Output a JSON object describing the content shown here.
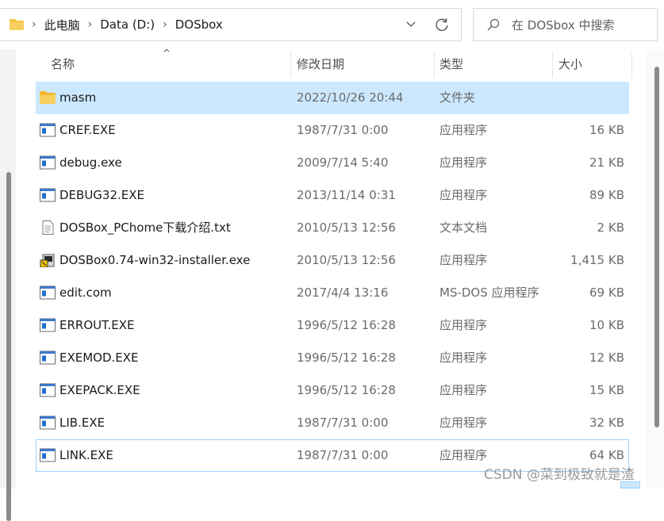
{
  "address_bar": {
    "breadcrumbs": [
      "此电脑",
      "Data (D:)",
      "DOSbox"
    ]
  },
  "search": {
    "placeholder": "在 DOSbox 中搜索"
  },
  "columns": {
    "name": "名称",
    "date": "修改日期",
    "type": "类型",
    "size": "大小"
  },
  "files": [
    {
      "name": "masm",
      "date": "2022/10/26 20:44",
      "type": "文件夹",
      "size": "",
      "icon": "folder-icon"
    },
    {
      "name": "CREF.EXE",
      "date": "1987/7/31 0:00",
      "type": "应用程序",
      "size": "16 KB",
      "icon": "exe-icon"
    },
    {
      "name": "debug.exe",
      "date": "2009/7/14 5:40",
      "type": "应用程序",
      "size": "21 KB",
      "icon": "exe-icon"
    },
    {
      "name": "DEBUG32.EXE",
      "date": "2013/11/14 0:31",
      "type": "应用程序",
      "size": "89 KB",
      "icon": "exe-icon"
    },
    {
      "name": "DOSBox_PChome下载介绍.txt",
      "date": "2010/5/13 12:56",
      "type": "文本文档",
      "size": "2 KB",
      "icon": "text-file-icon"
    },
    {
      "name": "DOSBox0.74-win32-installer.exe",
      "date": "2010/5/13 12:56",
      "type": "应用程序",
      "size": "1,415 KB",
      "icon": "installer-icon"
    },
    {
      "name": "edit.com",
      "date": "2017/4/4 13:16",
      "type": "MS-DOS 应用程序",
      "size": "69 KB",
      "icon": "exe-icon"
    },
    {
      "name": "ERROUT.EXE",
      "date": "1996/5/12 16:28",
      "type": "应用程序",
      "size": "10 KB",
      "icon": "exe-icon"
    },
    {
      "name": "EXEMOD.EXE",
      "date": "1996/5/12 16:28",
      "type": "应用程序",
      "size": "12 KB",
      "icon": "exe-icon"
    },
    {
      "name": "EXEPACK.EXE",
      "date": "1996/5/12 16:28",
      "type": "应用程序",
      "size": "15 KB",
      "icon": "exe-icon"
    },
    {
      "name": "LIB.EXE",
      "date": "1987/7/31 0:00",
      "type": "应用程序",
      "size": "32 KB",
      "icon": "exe-icon"
    },
    {
      "name": "LINK.EXE",
      "date": "1987/7/31 0:00",
      "type": "应用程序",
      "size": "64 KB",
      "icon": "exe-icon"
    }
  ],
  "watermark": "CSDN @菜到极致就是渣",
  "colors": {
    "selected_row": "#cce8ff",
    "hover_border": "#99d1ff",
    "folder": "#f5c342",
    "exe_blue": "#1e6fd0"
  }
}
